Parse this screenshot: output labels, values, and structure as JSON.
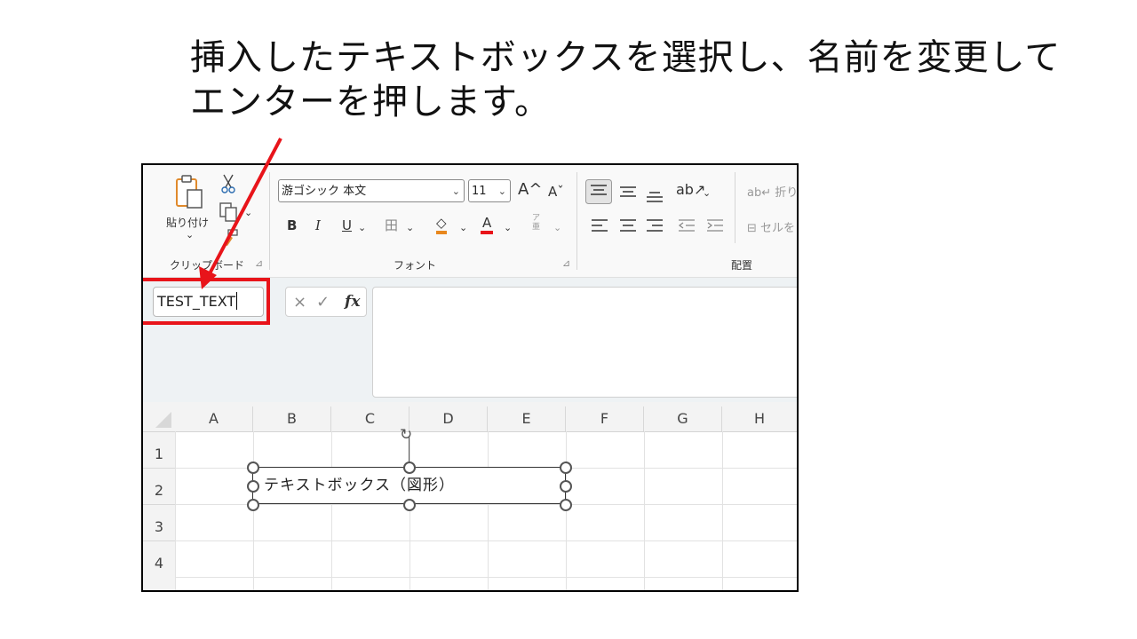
{
  "instruction": "挿入したテキストボックスを選択し、名前を変更して\nエンターを押します。",
  "colors": {
    "highlight": "#e8141a",
    "arrow": "#e8141a"
  },
  "ribbon": {
    "clipboard": {
      "paste_label": "貼り付け",
      "paste_dropdown": "⌄",
      "group_label": "クリップボード",
      "launcher": "⊿",
      "icons": [
        "clipboard-icon",
        "scissors-icon",
        "copy-icon",
        "format-painter-icon"
      ]
    },
    "font": {
      "font_name": "游ゴシック 本文",
      "font_size": "11",
      "grow_font": "A^",
      "shrink_font": "Aˇ",
      "bold": "B",
      "italic": "I",
      "underline": "U",
      "border": "田",
      "fill": "◇",
      "font_color": "A",
      "phonetic_top": "ア",
      "phonetic_bottom": "亜",
      "group_label": "フォント",
      "launcher": "⊿"
    },
    "alignment": {
      "wrap_text": "折り返",
      "merge": "セルを",
      "group_label": "配置"
    }
  },
  "namebox": {
    "value": "TEST_TEXT"
  },
  "formula_bar": {
    "cancel": "×",
    "enter": "✓",
    "fx": "fx",
    "value": ""
  },
  "sheet": {
    "columns": [
      "A",
      "B",
      "C",
      "D",
      "E",
      "F",
      "G",
      "H"
    ],
    "rows": [
      "1",
      "2",
      "3",
      "4"
    ]
  },
  "shape": {
    "text": "テキストボックス（図形）"
  }
}
